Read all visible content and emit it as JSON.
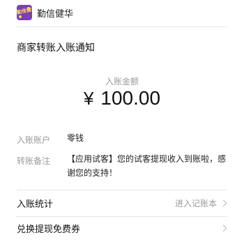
{
  "header": {
    "logo_text": "勤信健华",
    "app_name": "勤信健华"
  },
  "notice": {
    "title": "商家转账入账通知"
  },
  "amount": {
    "label": "入账金额",
    "currency": "¥",
    "value": "100.00"
  },
  "details": [
    {
      "label": "入账账户",
      "value": "零钱"
    },
    {
      "label": "转账备注",
      "value": "【应用试客】您的试客提现收入到账啦，感谢您的支持！"
    }
  ],
  "links": [
    {
      "label": "入账统计",
      "hint": "进入记账本",
      "icon": "chevron-right-icon"
    },
    {
      "label": "兑换提现免费券",
      "hint": "",
      "icon": "chevron-right-icon"
    }
  ],
  "colors": {
    "logo_bg": "#7b3fb7",
    "logo_fg": "#ffd84a",
    "muted_text": "#9b9b9b",
    "divider": "#e6e6e6"
  }
}
